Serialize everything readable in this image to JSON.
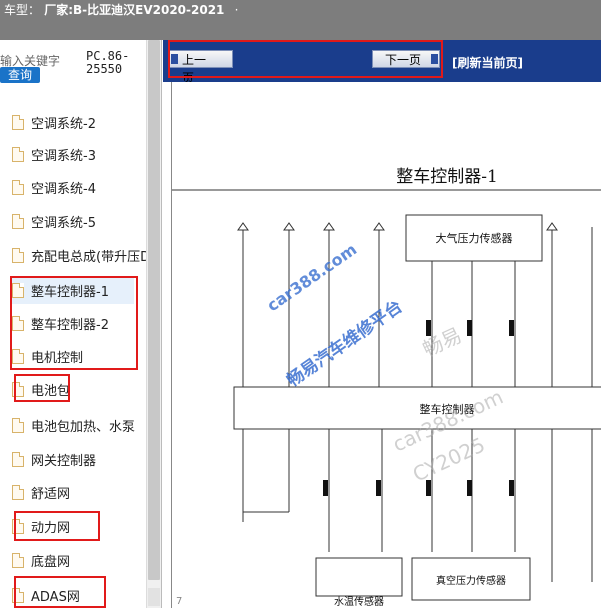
{
  "header": {
    "prefix": "车型：",
    "vehicle": "厂家:B-比亚迪汉EV2020-2021",
    "dot": "·"
  },
  "sidebar": {
    "search_hint": "输入关键字",
    "search_button": "查询",
    "pc_id_line1": "PC.86-",
    "pc_id_line2": "25550",
    "items": [
      {
        "label": "空调系统-2"
      },
      {
        "label": "空调系统-3"
      },
      {
        "label": "空调系统-4"
      },
      {
        "label": "空调系统-5"
      },
      {
        "label": "充配电总成(带升压DC)"
      },
      {
        "label": "整车控制器-1"
      },
      {
        "label": "整车控制器-2"
      },
      {
        "label": "电机控制"
      },
      {
        "label": "电池包"
      },
      {
        "label": "电池包加热、水泵"
      },
      {
        "label": "网关控制器"
      },
      {
        "label": "舒适网"
      },
      {
        "label": "动力网"
      },
      {
        "label": "底盘网"
      },
      {
        "label": "ADAS网"
      }
    ]
  },
  "viewer": {
    "prev_label": "上一页",
    "next_label": "下一页",
    "refresh_label": "[刷新当前页]",
    "diagram": {
      "title": "整车控制器-1",
      "sensor_top": "大气压力传感器",
      "controller": "整车控制器",
      "sensor_water": "水温传感器",
      "sensor_vacuum": "真空压力传感器",
      "watermark_line1": "car388.com",
      "watermark_line2": "畅易汽车维修平台",
      "watermark_line3": "畅易",
      "watermark_line4": "car388.com",
      "watermark_line5": "CY2025",
      "page_num": "7"
    }
  },
  "colors": {
    "titlebar": "#7d7d7d",
    "toolbar": "#1a3d8c",
    "accent": "#1a73c8",
    "highlight": "#e11a1a",
    "watermark": "#3a6fd0"
  }
}
